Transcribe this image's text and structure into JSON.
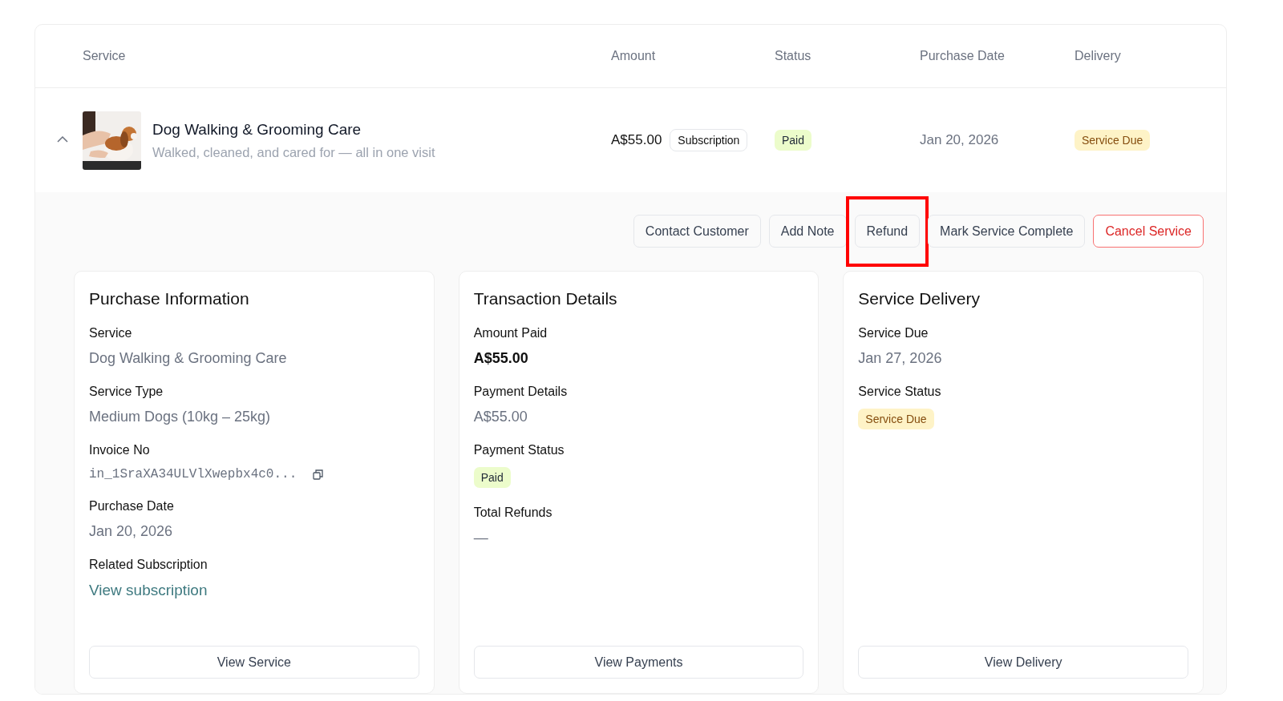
{
  "table": {
    "columns": [
      "Service",
      "Amount",
      "Status",
      "Purchase Date",
      "Delivery"
    ],
    "rows": [
      {
        "expanded": true,
        "name": "Dog Walking & Grooming Care",
        "description": "Walked, cleaned, and cared for — all in one visit",
        "amount": "A$55.00",
        "plan": "Subscription",
        "status": {
          "text": "Paid",
          "kind": "success"
        },
        "purchase_date": "Jan 20, 2026",
        "delivery": {
          "text": "Service Due",
          "kind": "warning"
        },
        "actions": [
          {
            "label": "Contact Customer",
            "kind": "default",
            "highlighted": false
          },
          {
            "label": "Add Note",
            "kind": "default",
            "highlighted": false
          },
          {
            "label": "Refund",
            "kind": "default",
            "highlighted": true
          },
          {
            "label": "Mark Service Complete",
            "kind": "default",
            "highlighted": false
          },
          {
            "label": "Cancel Service",
            "kind": "danger",
            "highlighted": false
          }
        ],
        "panels": [
          {
            "title": "Purchase Information",
            "fields": [
              {
                "label": "Service",
                "kind": "text",
                "value": "Dog Walking & Grooming Care"
              },
              {
                "label": "Service Type",
                "kind": "text",
                "value": "Medium Dogs (10kg – 25kg)"
              },
              {
                "label": "Invoice No",
                "kind": "code",
                "value": "in_1SraXA34ULVlXwepbx4c0..."
              },
              {
                "label": "Purchase Date",
                "kind": "text",
                "value": "Jan 20, 2026"
              },
              {
                "label": "Related Subscription",
                "kind": "link",
                "value": "View subscription"
              }
            ],
            "button": "View Service"
          },
          {
            "title": "Transaction Details",
            "fields": [
              {
                "label": "Amount Paid",
                "kind": "strong",
                "value": "A$55.00"
              },
              {
                "label": "Payment Details",
                "kind": "text",
                "value": "A$55.00"
              },
              {
                "label": "Payment Status",
                "kind": "success",
                "value": "Paid"
              },
              {
                "label": "Total Refunds",
                "kind": "text",
                "value": "—"
              }
            ],
            "button": "View Payments"
          },
          {
            "title": "Service Delivery",
            "fields": [
              {
                "label": "Service Due",
                "kind": "text",
                "value": "Jan 27, 2026"
              },
              {
                "label": "Service Status",
                "kind": "warning",
                "value": "Service Due"
              }
            ],
            "button": "View Delivery"
          }
        ]
      }
    ]
  }
}
